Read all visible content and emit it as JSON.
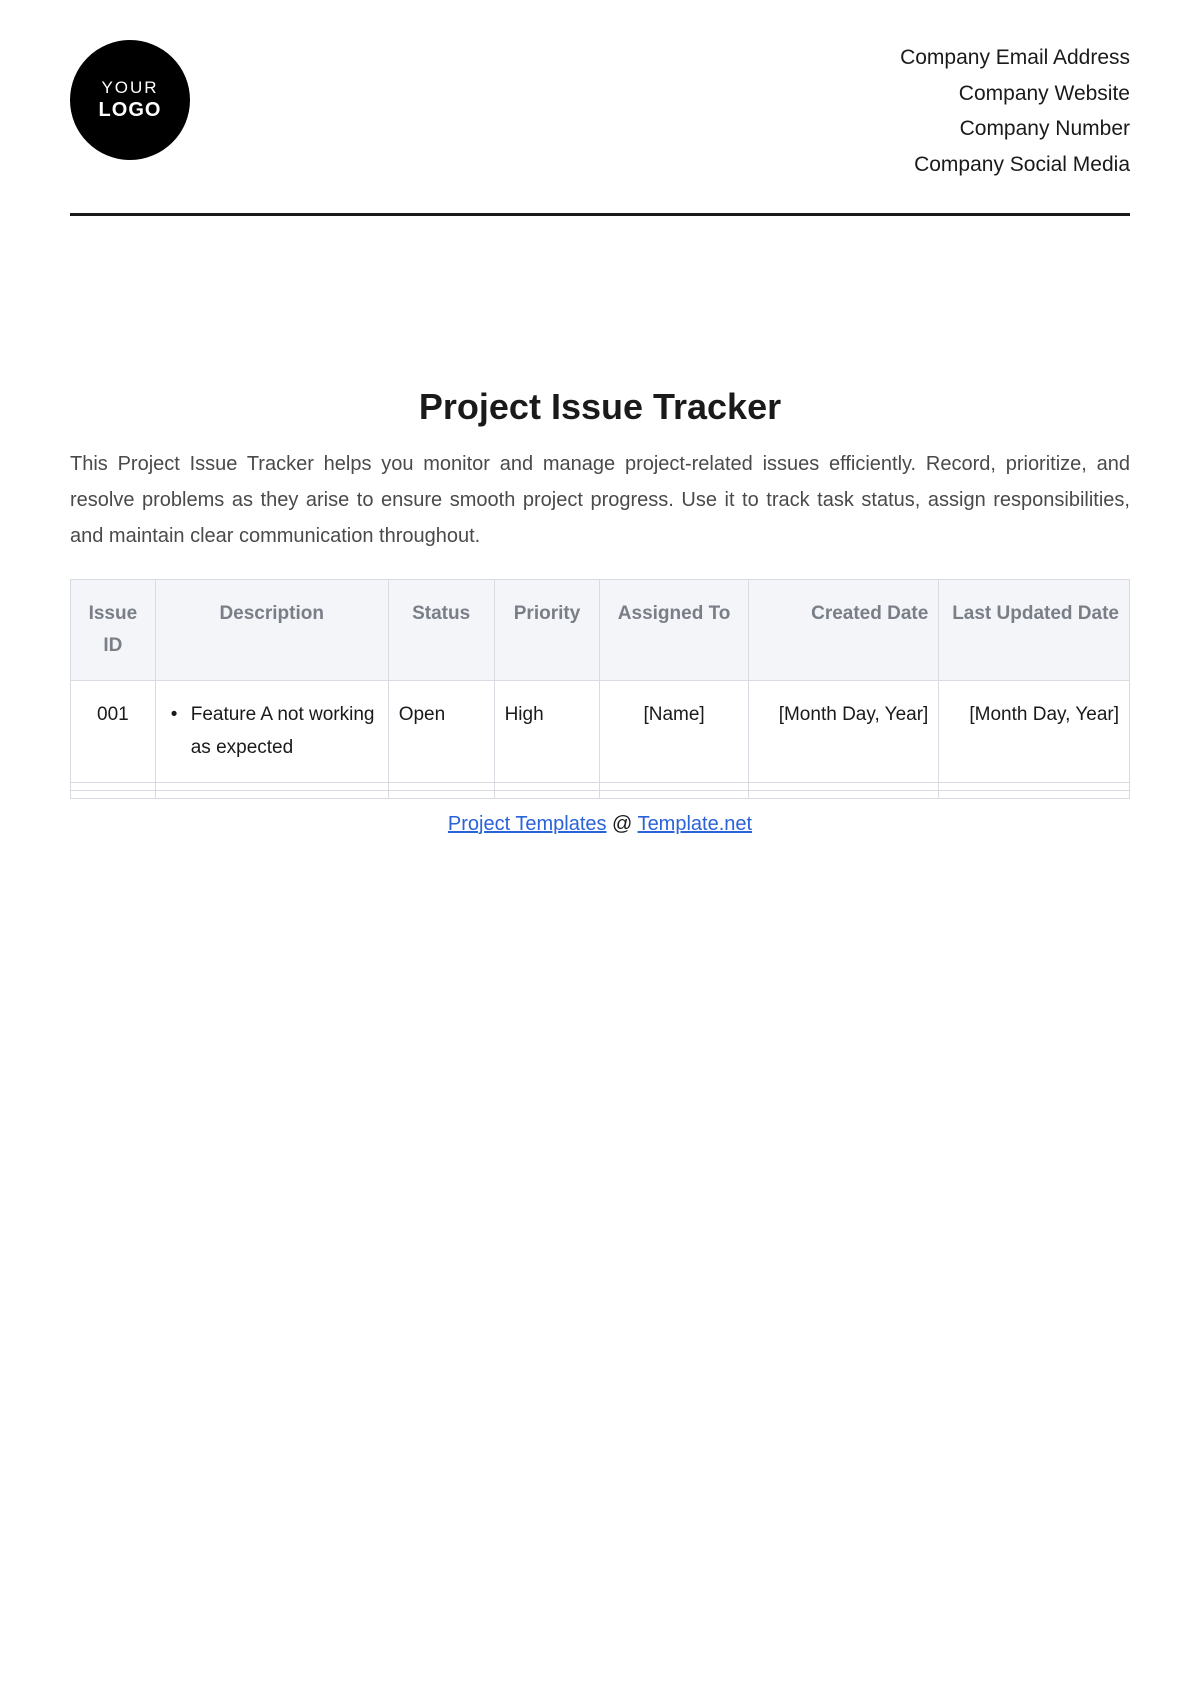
{
  "header": {
    "logo": {
      "line1": "YOUR",
      "line2": "LOGO"
    },
    "company": {
      "email": "Company Email Address",
      "website": "Company Website",
      "number": "Company Number",
      "social": "Company Social Media"
    }
  },
  "title": "Project Issue Tracker",
  "description": "This Project Issue Tracker helps you monitor and manage project-related issues efficiently. Record, prioritize, and resolve problems as they arise to ensure smooth project progress. Use it to track task status, assign responsibilities, and maintain clear communication throughout.",
  "table": {
    "headers": {
      "issue_id": "Issue ID",
      "description": "Description",
      "status": "Status",
      "priority": "Priority",
      "assigned_to": "Assigned To",
      "created_date": "Created Date",
      "last_updated": "Last Updated Date"
    },
    "rows": [
      {
        "id": "001",
        "description": "Feature A not working as expected",
        "status": "Open",
        "priority": "High",
        "assigned_to": "[Name]",
        "created_date": "[Month Day, Year]",
        "last_updated": "[Month Day, Year]"
      }
    ]
  },
  "footer": {
    "link1": "Project Templates",
    "separator": " @ ",
    "link2": "Template.net"
  }
}
